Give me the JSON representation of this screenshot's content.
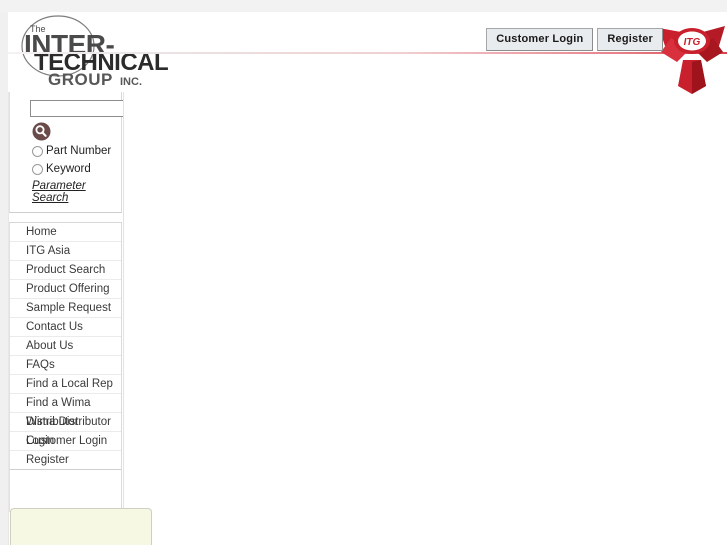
{
  "header": {
    "logo": {
      "the": "The",
      "line1": "INTER-",
      "line2": "TECHNICAL",
      "line3": "GROUP",
      "line3_suffix": "INC.",
      "alt": "The Inter-Technical Group Inc."
    },
    "buttons": [
      {
        "label": "Customer Login",
        "name": "customer-login-button"
      },
      {
        "label": "Register",
        "name": "register-button"
      }
    ],
    "badge": {
      "text": "ITG",
      "name": "itg-ribbon-badge",
      "color": "#c8202c"
    },
    "rule_colors": {
      "start": "#f4f2f2",
      "end": "#d8434f"
    }
  },
  "search": {
    "input_value": "",
    "placeholder": "",
    "icon_name": "magnifier-icon",
    "icon_color": "#6b4a4a",
    "options": [
      {
        "label": "Part Number",
        "checked": false
      },
      {
        "label": "Keyword",
        "checked": false
      }
    ],
    "parameter_search_label": "Parameter Search"
  },
  "nav": {
    "items": [
      {
        "label": "Home"
      },
      {
        "label": "ITG Asia"
      },
      {
        "label": "Product Search"
      },
      {
        "label": "Product Offering"
      },
      {
        "label": "Sample Request"
      },
      {
        "label": "Contact Us"
      },
      {
        "label": "About Us"
      },
      {
        "label": "FAQs"
      },
      {
        "label": "Find a Local Rep"
      },
      {
        "label": "Find a Wima"
      },
      {
        "label": "Distributor",
        "ghost": "Wima Distributor"
      },
      {
        "label": "Login",
        "ghost": "Customer Login"
      },
      {
        "label": "Register"
      }
    ]
  },
  "notice": {
    "text": "",
    "background": "#f7f8e4"
  },
  "main": {
    "content": ""
  }
}
